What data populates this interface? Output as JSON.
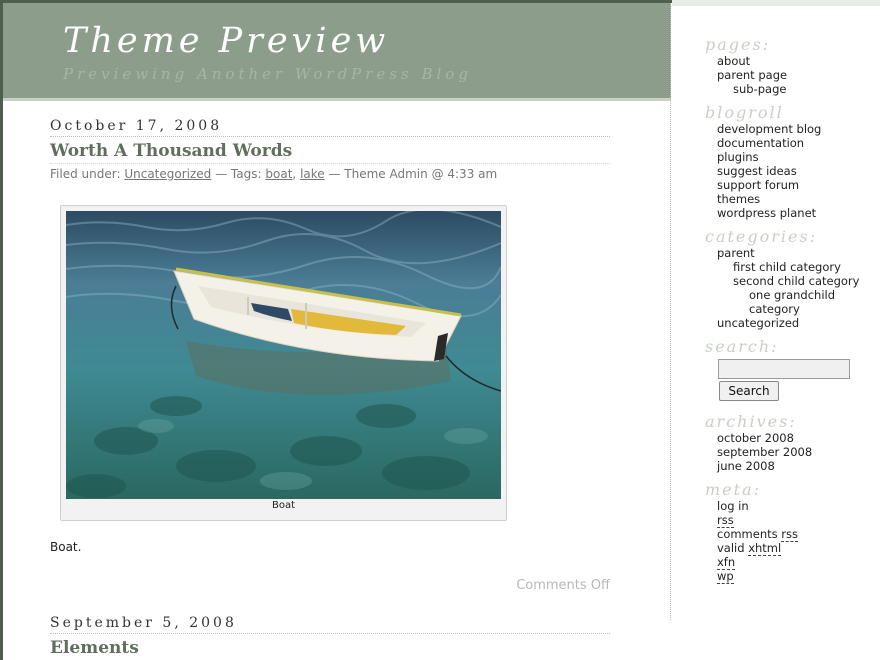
{
  "header": {
    "title": "Theme Preview",
    "description": "Previewing Another WordPress Blog"
  },
  "post1": {
    "date": "October 17, 2008",
    "title": "Worth A Thousand Words",
    "filed_label": "Filed under:",
    "category": "Uncategorized",
    "tags_label": "— Tags:",
    "tag1": "boat",
    "tag_sep": ",",
    "tag2": "lake",
    "byline": "— Theme Admin @ 4:33 am",
    "image_caption": "Boat",
    "body": "Boat.",
    "comments": "Comments Off"
  },
  "post2": {
    "date": "September 5, 2008",
    "title": "Elements"
  },
  "sidebar": {
    "pages_title": "pages:",
    "pages": [
      "about",
      "parent page",
      "sub-page"
    ],
    "blogroll_title": "blogroll",
    "blogroll": [
      "development blog",
      "documentation",
      "plugins",
      "suggest ideas",
      "support forum",
      "themes",
      "wordpress planet"
    ],
    "categories_title": "categories:",
    "categories": [
      "parent",
      "first child category",
      "second child category",
      "one grandchild",
      "category",
      "uncategorized"
    ],
    "search_title": "search:",
    "search_button": "Search",
    "search_value": "",
    "archives_title": "archives:",
    "archives": [
      "october 2008",
      "september 2008",
      "june 2008"
    ],
    "meta_title": "meta:",
    "meta_login": "log in",
    "meta_rss": "rss",
    "meta_comments": "comments",
    "meta_comments_rss": "rss",
    "meta_valid": "valid",
    "meta_xhtml": "xhtml",
    "meta_xfn": "xfn",
    "meta_wp": "wp"
  },
  "colors": {
    "header_bg": "#8d9d8c",
    "frame": "#4f5f4f",
    "post_title": "#5f6f5c",
    "widget_title": "#c8cfc6"
  }
}
